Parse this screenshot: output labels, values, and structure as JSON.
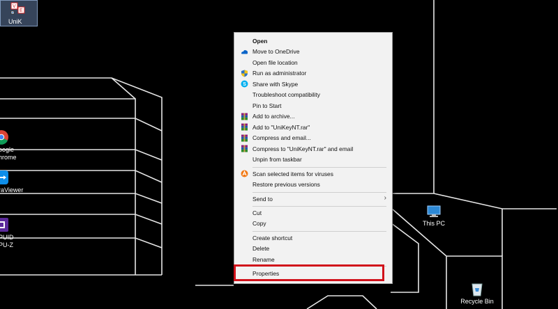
{
  "desktop": {
    "selected_icon": {
      "label": "UniK"
    },
    "left_icons": [
      {
        "label_line1": "oogle",
        "label_line2": "hrome",
        "icon": "chrome-icon"
      },
      {
        "label_line1": "raViewer",
        "label_line2": "",
        "icon": "teamviewer-icon"
      },
      {
        "label_line1": "PUID",
        "label_line2": "PU-Z",
        "icon": "cpuz-icon"
      }
    ],
    "this_pc": {
      "label": "This PC",
      "icon": "this-pc-icon"
    },
    "recycle_bin": {
      "label": "Recycle Bin",
      "icon": "recycle-bin-icon"
    }
  },
  "context_menu": {
    "items": [
      {
        "label": "Open",
        "icon": "",
        "bold": true
      },
      {
        "label": "Move to OneDrive",
        "icon": "onedrive-icon"
      },
      {
        "label": "Open file location",
        "icon": ""
      },
      {
        "label": "Run as administrator",
        "icon": "shield-icon"
      },
      {
        "label": "Share with Skype",
        "icon": "skype-icon"
      },
      {
        "label": "Troubleshoot compatibility",
        "icon": ""
      },
      {
        "label": "Pin to Start",
        "icon": ""
      },
      {
        "label": "Add to archive...",
        "icon": "winrar-icon"
      },
      {
        "label": "Add to \"UniKeyNT.rar\"",
        "icon": "winrar-icon"
      },
      {
        "label": "Compress and email...",
        "icon": "winrar-icon"
      },
      {
        "label": "Compress to \"UniKeyNT.rar\" and email",
        "icon": "winrar-icon"
      },
      {
        "label": "Unpin from taskbar",
        "icon": ""
      },
      {
        "label": "Scan selected items for viruses",
        "icon": "avast-icon"
      },
      {
        "label": "Restore previous versions",
        "icon": ""
      },
      {
        "label": "Send to",
        "icon": "",
        "submenu": true
      },
      {
        "label": "Cut",
        "icon": ""
      },
      {
        "label": "Copy",
        "icon": ""
      },
      {
        "label": "Create shortcut",
        "icon": ""
      },
      {
        "label": "Delete",
        "icon": ""
      },
      {
        "label": "Rename",
        "icon": ""
      },
      {
        "label": "Properties",
        "icon": "",
        "highlighted": true
      }
    ],
    "submenu_arrow": "›"
  },
  "colors": {
    "highlight_border": "#d1121b",
    "menu_background": "#f2f2f2",
    "desktop_background": "#000000"
  }
}
